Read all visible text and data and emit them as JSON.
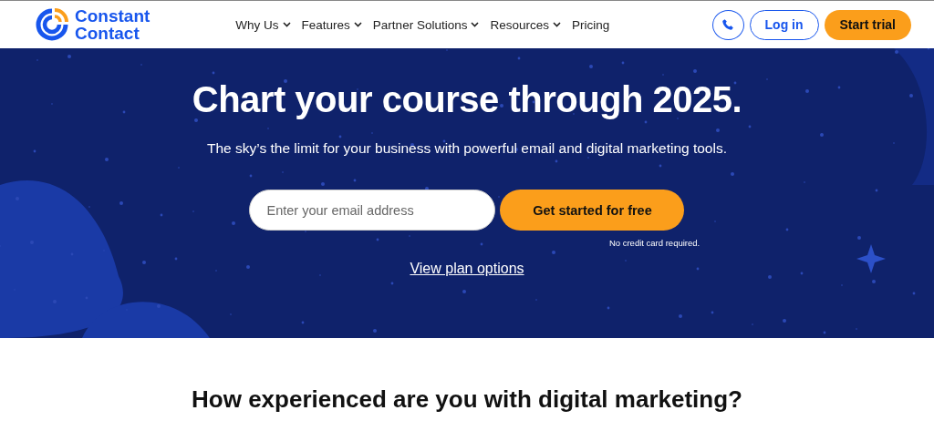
{
  "logo": {
    "line_1": "Constant",
    "line_2": "Contact"
  },
  "nav": [
    {
      "label": "Why Us",
      "dropdown": true
    },
    {
      "label": "Features",
      "dropdown": true
    },
    {
      "label": "Partner Solutions",
      "dropdown": true
    },
    {
      "label": "Resources",
      "dropdown": true
    },
    {
      "label": "Pricing",
      "dropdown": false
    }
  ],
  "header_actions": {
    "login": "Log in",
    "trial": "Start trial"
  },
  "hero": {
    "title": "Chart your course through 2025.",
    "subtitle": "The sky’s the limit for your business with powerful email and digital marketing tools.",
    "email_field": {
      "placeholder": "Enter your email address"
    },
    "cta": "Get started for free",
    "note": "No credit card required.",
    "link": "View plan options"
  },
  "section": {
    "heading": "How experienced are you with digital marketing?"
  }
}
